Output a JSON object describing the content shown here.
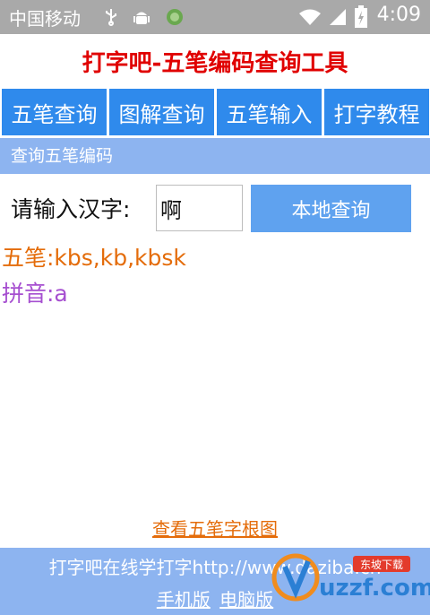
{
  "status_bar": {
    "carrier": "中国移动",
    "time": "4:09",
    "icons": [
      "usb-icon",
      "android-debug-icon",
      "sync-icon",
      "wifi-icon",
      "signal-icon",
      "battery-icon"
    ]
  },
  "app": {
    "title": "打字吧-五笔编码查询工具"
  },
  "nav": {
    "items": [
      {
        "label": "五笔查询"
      },
      {
        "label": "图解查询"
      },
      {
        "label": "五笔输入"
      },
      {
        "label": "打字教程"
      }
    ]
  },
  "query": {
    "section_title": "查询五笔编码",
    "label": "请输入汉字:",
    "input_value": "啊",
    "button_label": "本地查询"
  },
  "result": {
    "wubi": "五笔:kbs,kb,kbsk",
    "pinyin": "拼音:a"
  },
  "links": {
    "radical_chart": "查看五笔字根图"
  },
  "footer": {
    "line1": "打字吧在线学打字http://www.daziba.cn",
    "mobile_label": "手机版",
    "desktop_label": "电脑版"
  },
  "watermark": {
    "brand": "uzzf.com",
    "tagline": "东坡下载"
  },
  "colors": {
    "nav_blue": "#2f8aec",
    "header_light_blue": "#8db4f0",
    "title_red": "#e00000",
    "wubi_orange": "#e46c0a",
    "pinyin_purple": "#a64fd0"
  }
}
